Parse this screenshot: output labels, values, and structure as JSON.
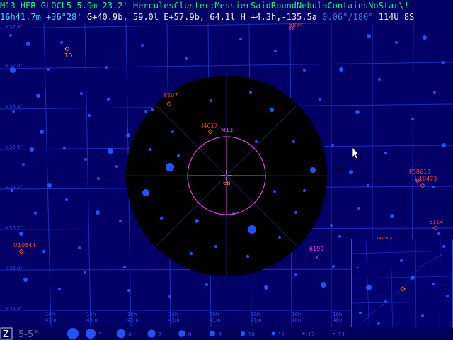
{
  "status": {
    "object_line": "M13 HER GLOCL5 5.9m 23.2' HerculesCluster;MessierSaidRoundNebulaContainsNoStar\\!",
    "ra": "16h41.7m",
    "dec": "+36°28'",
    "galactic": "G+40.9b, 59.0l",
    "ecliptic": "E+57.9b, 64.1l",
    "horizon": "H +4.3h,-135.5a",
    "fov": "0.06°/180°",
    "chart_no": "114U",
    "extra": "8S"
  },
  "colors": {
    "background": "#000066",
    "grid": "#2b3fd1",
    "star": "#1a55ff",
    "label_red": "#ff3a3a",
    "label_magenta": "#ff40ff",
    "cursor": "#ffffff",
    "dark_disc": "#000000"
  },
  "grid_labels": {
    "dec": [
      "+37.8°",
      "+37.0°",
      "+36.8°",
      "+36.6°",
      "+36.4°",
      "+36.2°",
      "+36.0°",
      "+35.8°",
      "+35.6°"
    ],
    "ra": [
      "16h\n43m",
      "16h\n43m",
      "16h\n42m",
      "16h\n42m",
      "16h\n41m",
      "16h\n41m",
      "16h\n40m",
      "16h\n40m",
      "16h\n39m"
    ]
  },
  "objects": [
    {
      "name": "5874",
      "kind": "red"
    },
    {
      "name": "1D",
      "kind": "orange"
    },
    {
      "name": "6207",
      "kind": "red"
    },
    {
      "name": "I4617",
      "kind": "red"
    },
    {
      "name": "M13",
      "kind": "magenta"
    },
    {
      "name": "6B",
      "kind": "orange"
    },
    {
      "name": "P58613",
      "kind": "red"
    },
    {
      "name": "U10473",
      "kind": "red"
    },
    {
      "name": "6114",
      "kind": "red"
    },
    {
      "name": "U10544",
      "kind": "red"
    },
    {
      "name": "6199",
      "kind": "magenta"
    },
    {
      "name": "I4614",
      "kind": "red"
    }
  ],
  "footer": {
    "z_label": "Z",
    "magnitude_range": "5-5°",
    "magnitude_steps": [
      "5",
      "6",
      "7",
      "8",
      "9",
      "10",
      "11",
      "12",
      "13"
    ]
  }
}
